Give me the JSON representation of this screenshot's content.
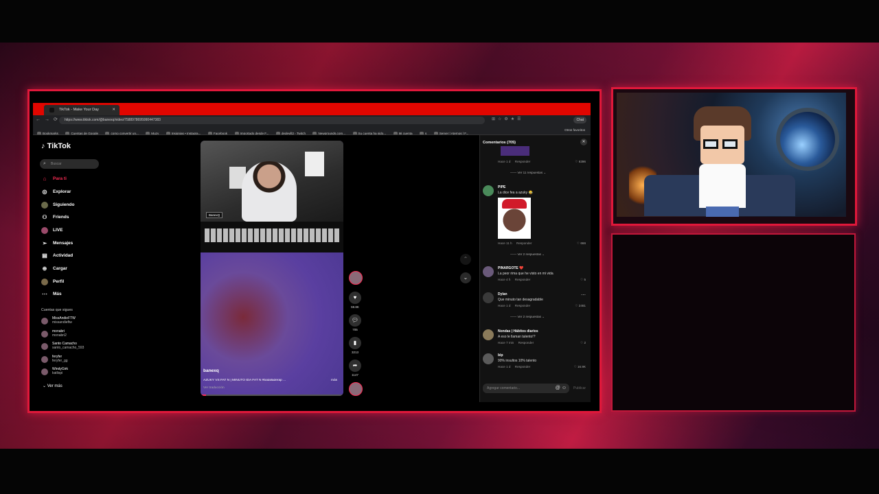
{
  "browser": {
    "tab_title": "TikTok - Make Your Day",
    "url": "https://www.tiktok.com/@banexq/video/7588978695990447383",
    "chat_label": "Chat",
    "bookmarks": [
      "Bookmarks",
      "Cuentas de Google",
      "como convertir un...",
      "Muzy",
      "Insignias • Instagra...",
      "Facebook",
      "Importado desde F...",
      "dedevill2 - Twitch",
      "Newgrounds.com...",
      "Su cuenta ha sido...",
      "Mi cuenta",
      "s",
      "Server | Aternos | F..."
    ],
    "other_bookmarks": "Otros favoritos"
  },
  "tiktok": {
    "logo": "TikTok",
    "search_placeholder": "Buscar",
    "nav": [
      "Para ti",
      "Explorar",
      "Siguiendo",
      "Friends",
      "LIVE",
      "Mensajes",
      "Actividad",
      "Cargar",
      "Perfil",
      "Más"
    ],
    "following_title": "Cuentas que sigues",
    "following": [
      {
        "name": "MissAndieFTW",
        "handle": "missandieftw"
      },
      {
        "name": "monabri",
        "handle": "monabri2"
      },
      {
        "name": "Santo Camacho",
        "handle": "santo_camacho_593"
      },
      {
        "name": "feryfer",
        "handle": "feryfer_gg"
      },
      {
        "name": "WindyGirk",
        "handle": "katlispi"
      }
    ],
    "see_more": "Ver más"
  },
  "video": {
    "nametag": "BanexQ",
    "author": "banexq",
    "description": "AZUKY VS FAT N | MINUTO IDA FAT N #batalladerap ...",
    "more": "más",
    "translate": "Ver traducción",
    "progress": 0.04,
    "likes": "59.8K",
    "comments": "705",
    "saves": "3213",
    "shares": "1147"
  },
  "comments_panel": {
    "title": "Comentarios (705)",
    "first_meta": {
      "time": "Hace 1 d",
      "reply": "Responder",
      "likes": "6396",
      "replies": "Ver 11 respuestas"
    },
    "comments": [
      {
        "user": "PIPE",
        "text": "La dice fea a azuky 😂",
        "time": "Hace 11 h",
        "reply": "Responder",
        "likes": "666",
        "replies": "Ver 2 respuestas"
      },
      {
        "user": "PINARGOTE ❤️",
        "text": "La peor rima que he visto en mi vida",
        "time": "Hace 4 h",
        "reply": "Responder",
        "likes": "5",
        "replies": ""
      },
      {
        "user": "Dylan",
        "text": "Que minuto tan desagradable",
        "time": "Hace 1 d",
        "reply": "Responder",
        "likes": "2461",
        "replies": "Ver 2 respuestas"
      },
      {
        "user": "Nondas | Hábitos diarios",
        "text": "A eso le llaman talento!?",
        "time": "Hace 7 min",
        "reply": "Responder",
        "likes": "2",
        "replies": ""
      },
      {
        "user": "bip",
        "text": "90% insultos 10% talento",
        "time": "Hace 1 d",
        "reply": "Responder",
        "likes": "16.9K",
        "replies": ""
      }
    ],
    "input_placeholder": "Agregar comentario...",
    "publish": "Publicar"
  },
  "colors": {
    "accent": "#fe2c55",
    "frame": "#e0183a",
    "tabbar": "#e10600"
  }
}
